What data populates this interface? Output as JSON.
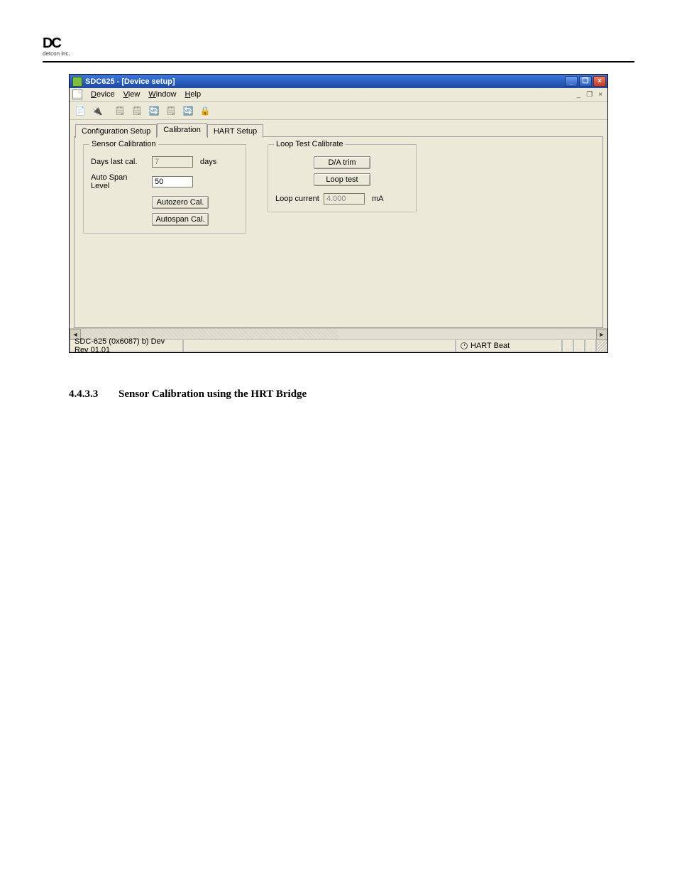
{
  "logo": {
    "text": "DC",
    "sub": "detcon inc."
  },
  "window": {
    "title": "SDC625 - [Device setup]",
    "mdi": {
      "min": "_",
      "restore": "❐",
      "close": "×"
    }
  },
  "menubar": {
    "items": [
      {
        "label": "Device",
        "accel": "D"
      },
      {
        "label": "View",
        "accel": "V"
      },
      {
        "label": "Window",
        "accel": "W"
      },
      {
        "label": "Help",
        "accel": "H"
      }
    ]
  },
  "tabs": [
    {
      "label": "Configuration Setup",
      "active": false
    },
    {
      "label": "Calibration",
      "active": true
    },
    {
      "label": "HART Setup",
      "active": false
    }
  ],
  "sensor_calibration": {
    "legend": "Sensor Calibration",
    "days_label": "Days last cal.",
    "days_value": "7",
    "days_unit": "days",
    "span_label": "Auto Span Level",
    "span_value": "50",
    "autozero_btn": "Autozero Cal.",
    "autospan_btn": "Autospan Cal."
  },
  "loop_calibrate": {
    "legend": "Loop Test Calibrate",
    "da_trim_btn": "D/A trim",
    "loop_test_btn": "Loop test",
    "current_label": "Loop current",
    "current_value": "4.000",
    "current_unit": "mA"
  },
  "statusbar": {
    "left": "SDC-625   (0x6087) b) Dev Rev 01.01",
    "hart": "HART Beat"
  },
  "doc_heading": {
    "num": "4.4.3.3",
    "title": "Sensor Calibration using the HRT Bridge"
  }
}
